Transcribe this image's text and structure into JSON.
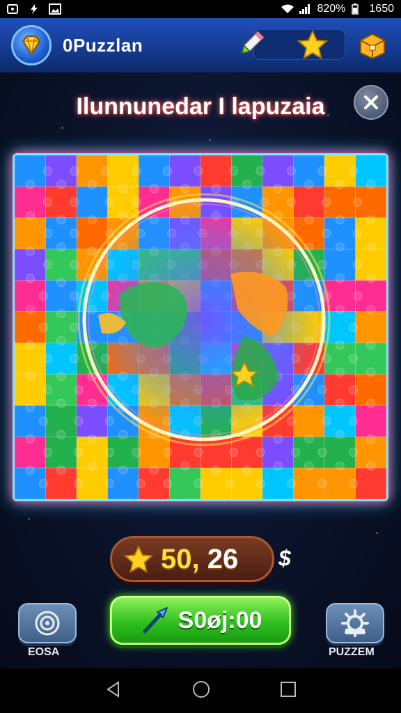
{
  "status_bar": {
    "battery": "820%",
    "time": "1650"
  },
  "app_bar": {
    "title": "0Puzzlan"
  },
  "puzzle": {
    "title": "Ilunnunedar I lapuzaia",
    "colors": [
      "#ff3b30",
      "#ff9500",
      "#ffcc00",
      "#34c759",
      "#1e90ff",
      "#7b4dff",
      "#ff2d92",
      "#00c6ff",
      "#23b14d",
      "#ff6a00"
    ]
  },
  "score": {
    "value_main": "50,",
    "value_rest": " 26",
    "suffix": "$"
  },
  "play_button": {
    "label": "S0øj:00"
  },
  "left_button": {
    "label": "EOSA"
  },
  "right_button": {
    "label": "PUZZEM"
  },
  "theme": {
    "accent_green": "#2fbf1f",
    "glow_blue": "#39c8ff",
    "glow_red": "#ff2a6a"
  }
}
